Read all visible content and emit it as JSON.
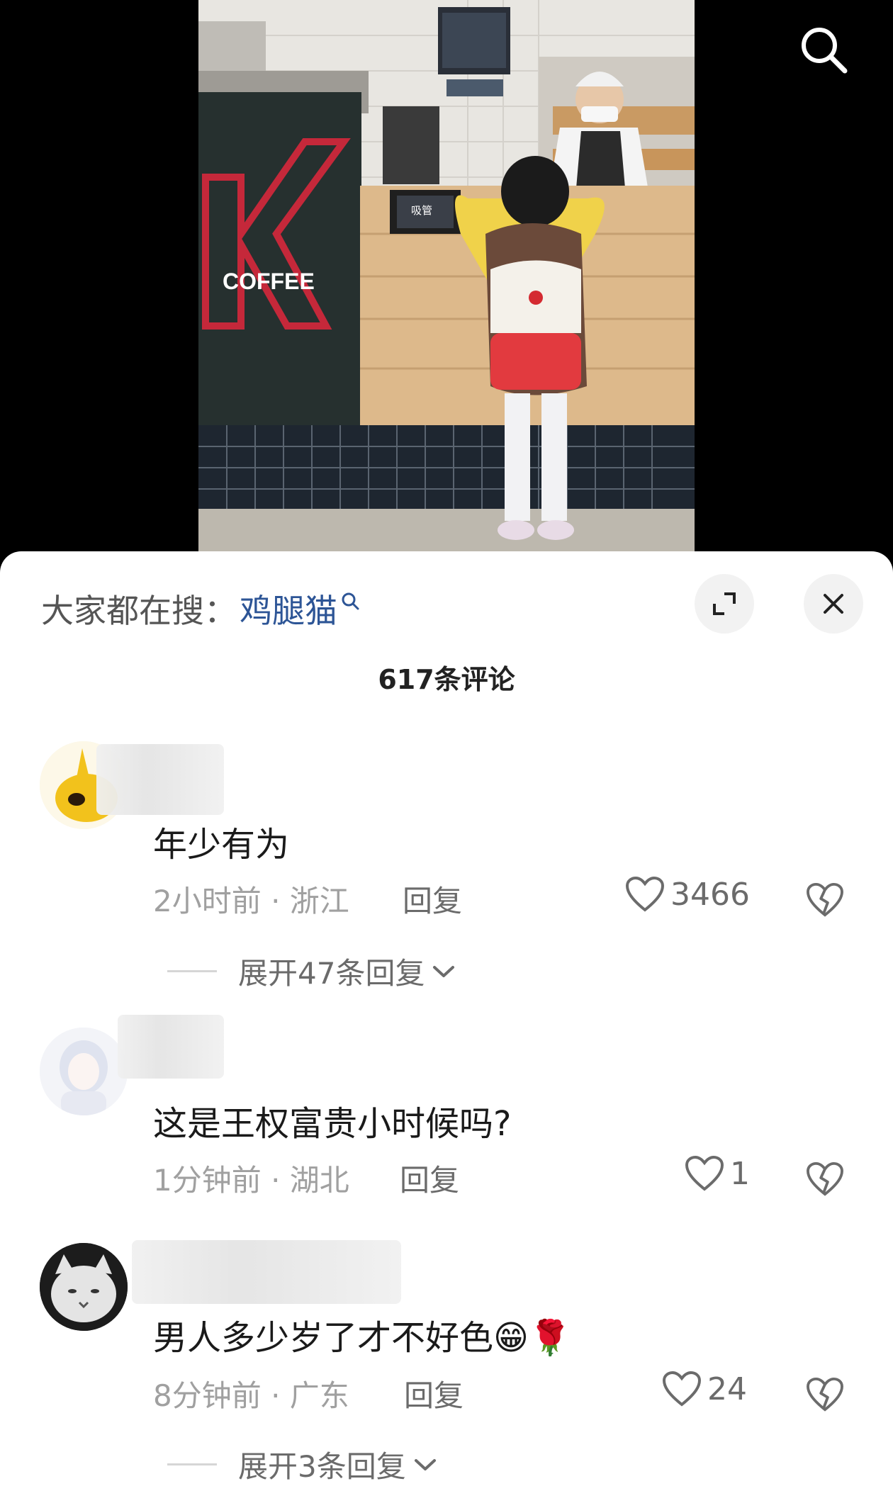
{
  "video": {
    "sign_text": "COFFEE",
    "counter_sign": "吸管"
  },
  "sheet": {
    "trend_prefix": "大家都在搜：",
    "trend_term": "鸡腿猫",
    "comment_count": "617条评论"
  },
  "comments": [
    {
      "text": "年少有为",
      "time": "2小时前",
      "location": "浙江",
      "reply_label": "回复",
      "likes": "3466",
      "expand_label": "展开47条回复"
    },
    {
      "text": "这是王权富贵小时候吗?",
      "time": "1分钟前",
      "location": "湖北",
      "reply_label": "回复",
      "likes": "1"
    },
    {
      "text": "男人多少岁了才不好色😁🌹",
      "time": "8分钟前",
      "location": "广东",
      "reply_label": "回复",
      "likes": "24",
      "expand_label": "展开3条回复"
    }
  ],
  "icons": {
    "search": "search-icon",
    "expand": "expand-icon",
    "close": "close-icon",
    "like": "heart-outline-icon",
    "dislike": "broken-heart-icon",
    "chevron": "chevron-down-icon"
  },
  "colors": {
    "trend_term": "#2d5596",
    "meta_text": "#a0a0a0",
    "sheet_bg": "#ffffff"
  }
}
